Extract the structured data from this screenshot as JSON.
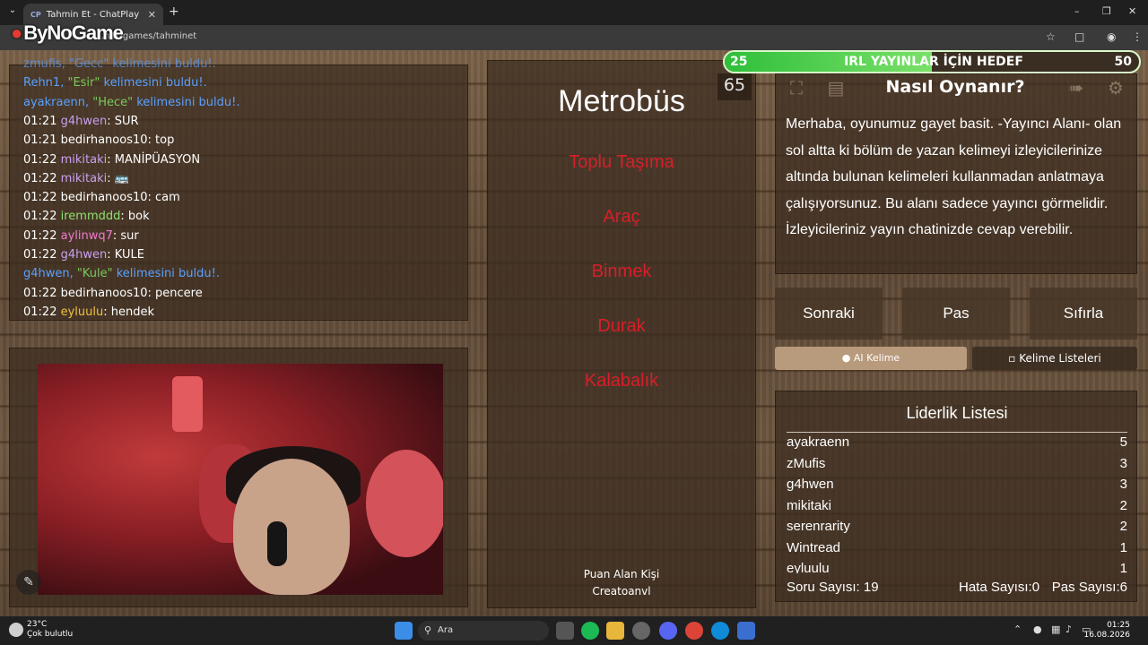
{
  "browser": {
    "tab_title": "Tahmin Et - ChatPlay",
    "tab_favicon": "CP",
    "url": "…n.tr/games/tahminet",
    "overlay_logo": "ByNoGame"
  },
  "chat": {
    "lines": [
      {
        "time": "",
        "user": "",
        "text": "zmufis, \"Gecc\" kelimesini buldu!.",
        "type": "found-partial",
        "user_color": "#5aa0ff"
      },
      {
        "time": "",
        "user": "Rehn1,",
        "word": "\"Esir\"",
        "text": " kelimesini buldu!.",
        "type": "found",
        "user_color": "#5aa0ff"
      },
      {
        "time": "",
        "user": "ayakraenn,",
        "word": "\"Hece\"",
        "text": " kelimesini buldu!.",
        "type": "found",
        "user_color": "#5aa0ff"
      },
      {
        "time": "01:21",
        "user": "g4hwen",
        "text": ": SUR",
        "type": "msg",
        "user_color": "#c9a0f0"
      },
      {
        "time": "01:21",
        "user": "bedirhanoos10",
        "text": ": top",
        "type": "msg",
        "user_color": "#ffffff"
      },
      {
        "time": "01:22",
        "user": "mikitaki",
        "text": ": MANİPÜASYON",
        "type": "msg",
        "user_color": "#c9a0f0"
      },
      {
        "time": "01:22",
        "user": "mikitaki",
        "text": ": 🚌",
        "type": "msg",
        "user_color": "#c9a0f0"
      },
      {
        "time": "01:22",
        "user": "bedirhanoos10",
        "text": ": cam",
        "type": "msg",
        "user_color": "#ffffff"
      },
      {
        "time": "01:22",
        "user": "iremmddd",
        "text": ": bok",
        "type": "msg",
        "user_color": "#8ee070"
      },
      {
        "time": "01:22",
        "user": "aylinwq7",
        "text": ": sur",
        "type": "msg",
        "user_color": "#f07ad0"
      },
      {
        "time": "01:22",
        "user": "g4hwen",
        "text": ": KULE",
        "type": "msg",
        "user_color": "#c9a0f0"
      },
      {
        "time": "",
        "user": "g4hwen,",
        "word": "\"Kule\"",
        "text": " kelimesini buldu!.",
        "type": "found",
        "user_color": "#5aa0ff"
      },
      {
        "time": "01:22",
        "user": "bedirhanoos10",
        "text": ": pencere",
        "type": "msg",
        "user_color": "#ffffff"
      },
      {
        "time": "01:22",
        "user": "eyluulu",
        "text": ": hendek",
        "type": "msg",
        "user_color": "#f0c040"
      }
    ]
  },
  "card": {
    "word": "Metrobüs",
    "forbidden": [
      "Toplu Taşıma",
      "Araç",
      "Binmek",
      "Durak",
      "Kalabalık"
    ],
    "point_label": "Puan Alan Kişi",
    "point_user": "Creatoanvl"
  },
  "goal": {
    "current": "25",
    "label": "IRL YAYINLAR İÇİN HEDEF",
    "target": "50",
    "progress": 0.5
  },
  "timer": "65",
  "howto": {
    "title": "Nasıl Oynanır?",
    "text": "Merhaba, oyunumuz gayet basit. -Yayıncı Alanı- olan sol altta ki bölüm de yazan kelimeyi izleyicilerinize altında bulunan kelimeleri kullanmadan anlatmaya çalışıyorsunuz. Bu alanı sadece yayıncı görmelidir. İzleyicileriniz yayın chatinizde cevap verebilir."
  },
  "actions": {
    "next": "Sonraki",
    "pass": "Pas",
    "reset": "Sıfırla"
  },
  "tabs": {
    "ai": "AI Kelime",
    "lists": "Kelime Listeleri"
  },
  "leaderboard": {
    "title": "Liderlik Listesi",
    "rows": [
      {
        "name": "ayakraenn",
        "score": "5"
      },
      {
        "name": "zMufis",
        "score": "3"
      },
      {
        "name": "g4hwen",
        "score": "3"
      },
      {
        "name": "mikitaki",
        "score": "2"
      },
      {
        "name": "serenrarity",
        "score": "2"
      },
      {
        "name": "Wintread",
        "score": "1"
      },
      {
        "name": "eyluulu",
        "score": "1"
      }
    ],
    "questions_label": "Soru Sayısı:",
    "questions": "19",
    "errors_label": "Hata Sayısı:",
    "errors": "0",
    "passes_label": "Pas Sayısı:",
    "passes": "6"
  },
  "taskbar": {
    "temp": "23°C",
    "weather": "Çok bulutlu",
    "search": "Ara",
    "time": "01:25",
    "date": "16.08.2026"
  }
}
